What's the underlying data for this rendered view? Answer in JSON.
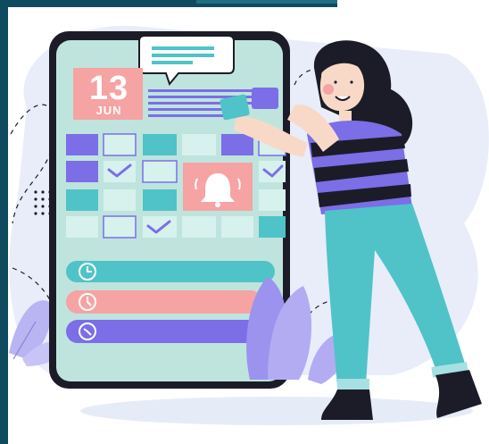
{
  "calendar": {
    "day": "13",
    "month": "JUN"
  },
  "colors": {
    "frame": "#0f4a5e",
    "phone_body": "#bfe4dd",
    "teal": "#4fc3c8",
    "violet": "#7b6ee6",
    "coral": "#f6a3a3",
    "dark": "#1c1c28"
  },
  "icons": [
    "clock-icon",
    "bell-icon",
    "checkmark-icon",
    "speech-bubble-icon"
  ]
}
